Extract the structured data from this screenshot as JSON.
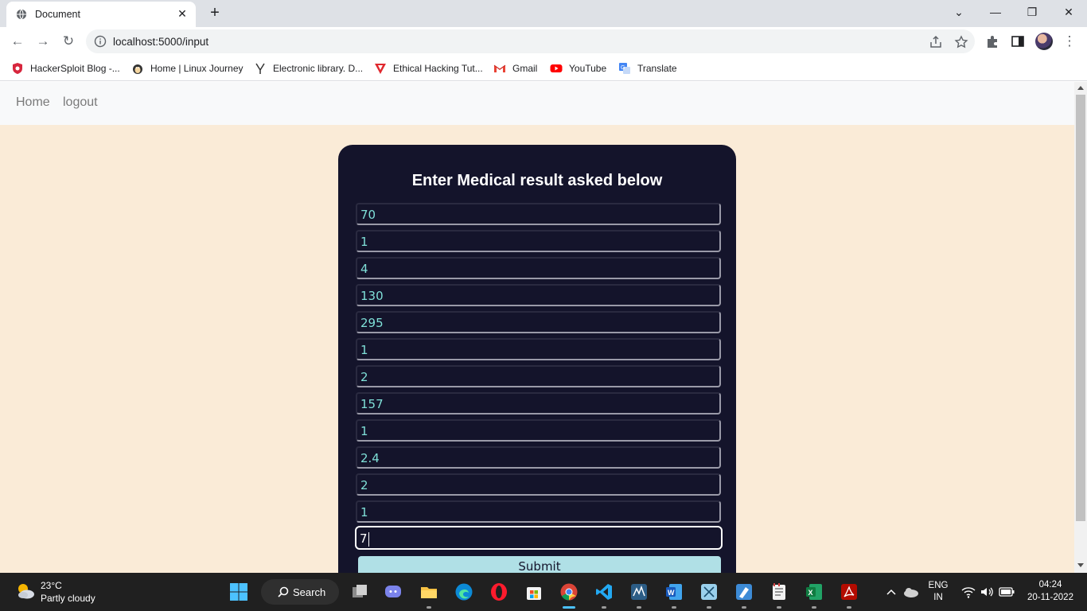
{
  "browser": {
    "tab_title": "Document",
    "url": "localhost:5000/input",
    "bookmarks": [
      {
        "label": "HackerSploit Blog -...",
        "icon": "hackersploit-icon"
      },
      {
        "label": "Home | Linux Journey",
        "icon": "penguin-icon"
      },
      {
        "label": "Electronic library. D...",
        "icon": "zlibrary-icon"
      },
      {
        "label": "Ethical Hacking Tut...",
        "icon": "hacking-icon"
      },
      {
        "label": "Gmail",
        "icon": "gmail-icon"
      },
      {
        "label": "YouTube",
        "icon": "youtube-icon"
      },
      {
        "label": "Translate",
        "icon": "translate-icon"
      }
    ]
  },
  "navbar": {
    "home": "Home",
    "logout": "logout"
  },
  "form": {
    "title": "Enter Medical result asked below",
    "fields": [
      "70",
      "1",
      "4",
      "130",
      "295",
      "1",
      "2",
      "157",
      "1",
      "2.4",
      "2",
      "1",
      "7"
    ],
    "submit_label": "Submit"
  },
  "taskbar": {
    "weather_temp": "23°C",
    "weather_desc": "Partly cloudy",
    "search_label": "Search",
    "lang_top": "ENG",
    "lang_bottom": "IN",
    "time": "04:24",
    "date": "20-11-2022"
  },
  "colors": {
    "page_bg": "#faebd7",
    "card_bg": "#14142b",
    "field_text": "#7fe0d8",
    "submit_bg": "#b0e0e6"
  }
}
